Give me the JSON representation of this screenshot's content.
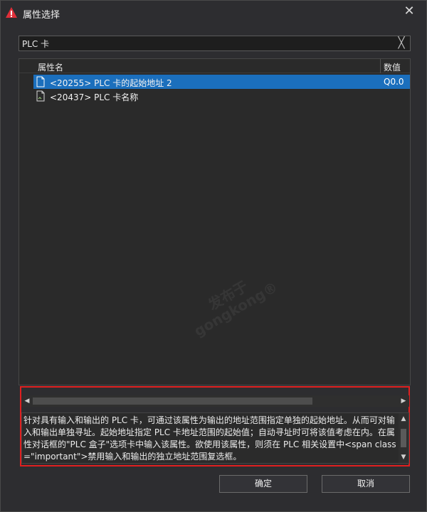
{
  "window": {
    "title": "属性选择",
    "close_glyph": "✕",
    "icon": "warning-triangle-icon",
    "accent_color": "#e0303a"
  },
  "search": {
    "value": "PLC 卡",
    "clear_glyph": "╳"
  },
  "list": {
    "columns": {
      "name": "属性名",
      "value": "数值"
    },
    "rows": [
      {
        "label": "<20255> PLC 卡的起始地址 2",
        "value": "Q0.0",
        "selected": true,
        "icon": "document-icon"
      },
      {
        "label": "<20437> PLC 卡名称",
        "value": "",
        "selected": false,
        "icon": "document-icon"
      }
    ],
    "selection_color": "#1b6fbd"
  },
  "watermark": {
    "line1": "发布于",
    "line2": "gongkong®"
  },
  "scrollbars": {
    "left": "◀",
    "right": "▶",
    "up": "▲",
    "down": "▼"
  },
  "description": {
    "text": "针对具有输入和输出的 PLC 卡，可通过该属性为输出的地址范围指定单独的起始地址。从而可对输入和输出单独寻址。起始地址指定 PLC 卡地址范围的起始值；自动寻址时可将该值考虑在内。在属性对话框的\"PLC 盒子\"选项卡中输入该属性。欲使用该属性，则须在 PLC 相关设置中<span class =\"important\">禁用输入和输出的独立地址范围复选框。"
  },
  "buttons": {
    "ok": "确定",
    "cancel": "取消"
  }
}
